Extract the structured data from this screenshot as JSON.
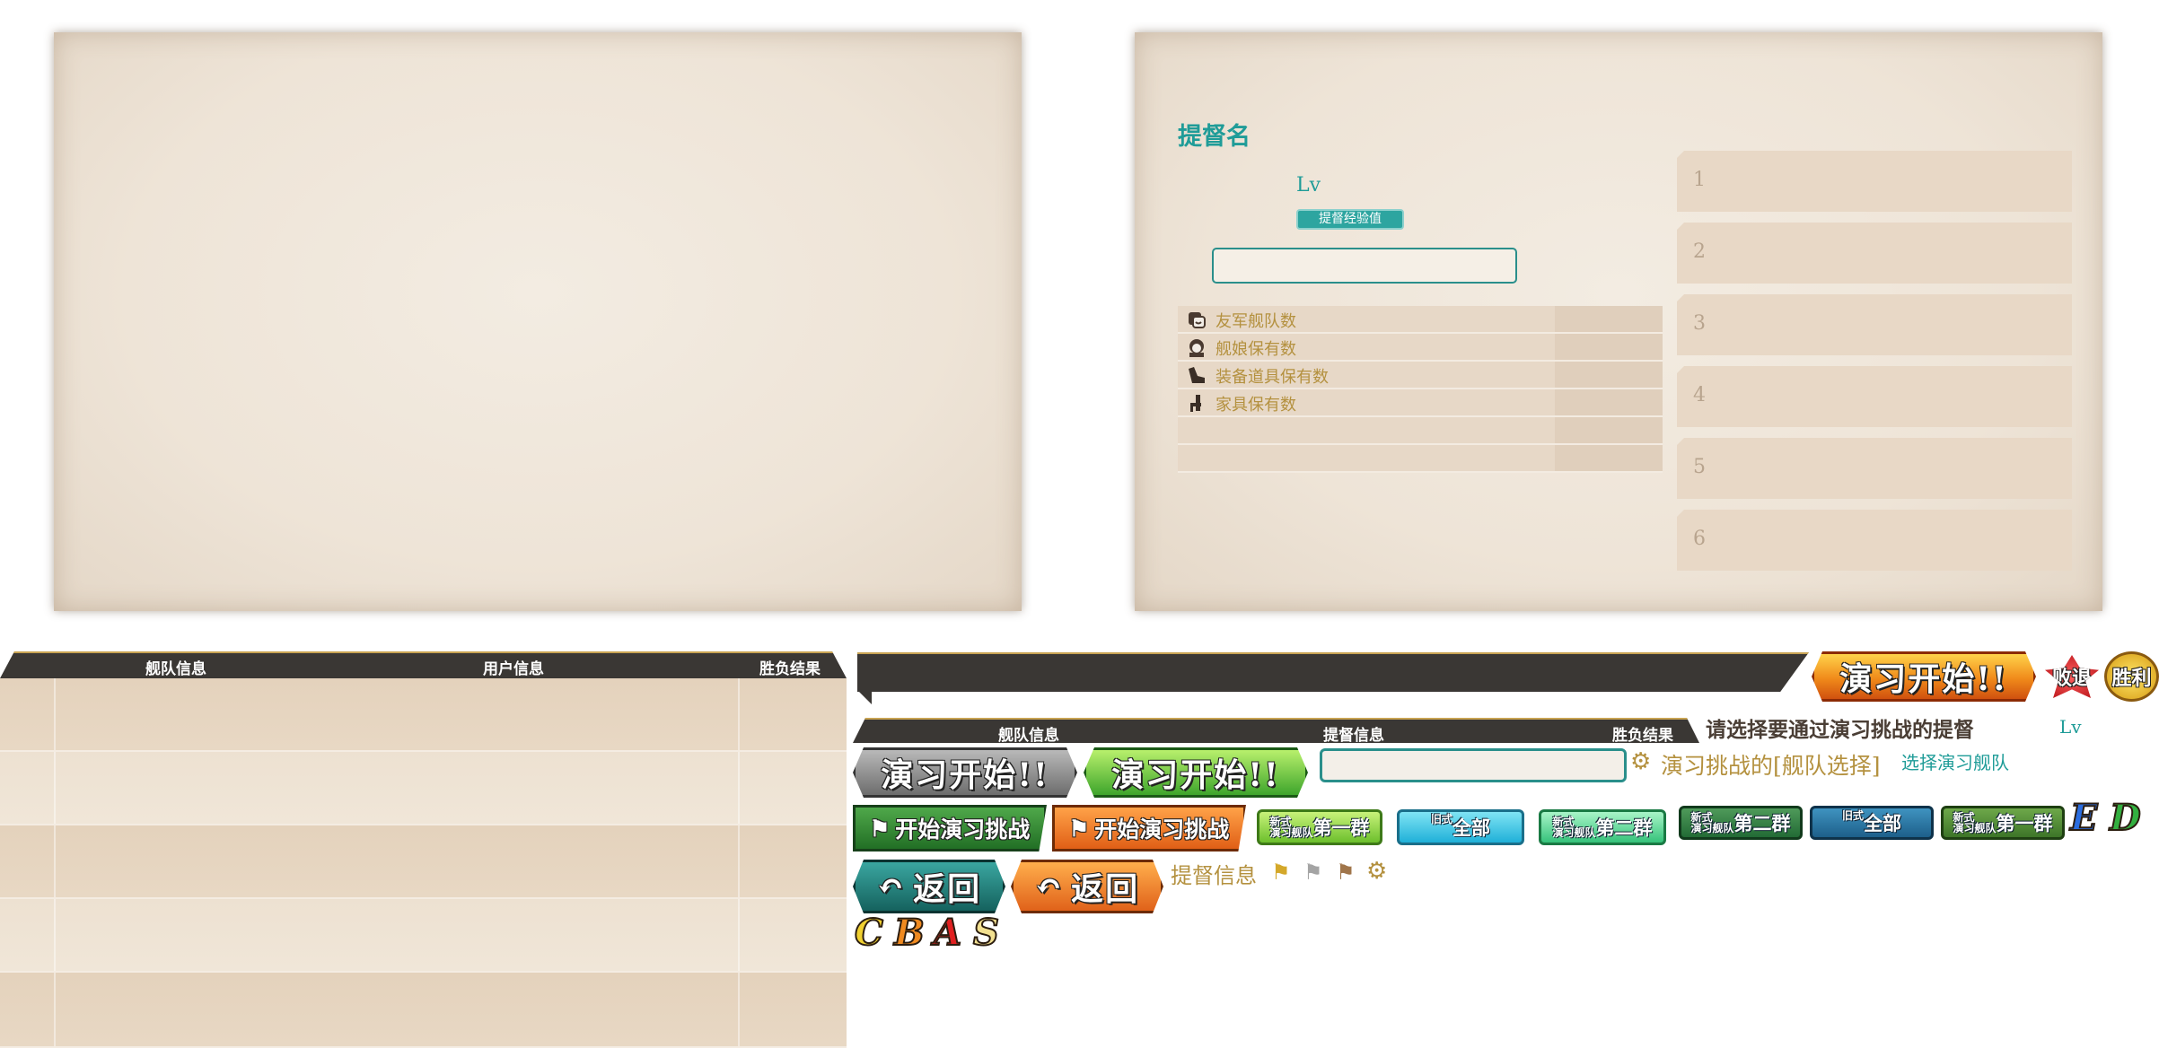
{
  "profile": {
    "admiral_name": "提督名",
    "lv_label": "Lv",
    "exp_label": "提督经验值",
    "stats": [
      {
        "icon": "friend-fleet-icon",
        "label": "友军舰队数"
      },
      {
        "icon": "shipgirl-icon",
        "label": "舰娘保有数"
      },
      {
        "icon": "equipment-icon",
        "label": "装备道具保有数"
      },
      {
        "icon": "furniture-icon",
        "label": "家具保有数"
      },
      {
        "icon": "",
        "label": ""
      },
      {
        "icon": "",
        "label": ""
      }
    ],
    "slots": [
      "1",
      "2",
      "3",
      "4",
      "5",
      "6"
    ]
  },
  "list_header": {
    "fleet": "舰队信息",
    "user": "用户信息",
    "result": "胜负结果"
  },
  "list_header_small": {
    "fleet": "舰队信息",
    "admiral": "提督信息",
    "result": "胜负结果"
  },
  "buttons": {
    "start_exercise": "演习开始!!",
    "defeat": "败退",
    "victory": "胜利",
    "start_challenge": "开始演习挑战",
    "back": "返回",
    "fleet_new_first_small": "新式",
    "fleet_new_first_sub": "演习舰队",
    "fleet_first": "第一群",
    "fleet_second": "第二群",
    "fleet_old_small": "旧式",
    "fleet_all": "全部"
  },
  "texts": {
    "select_prompt": "请选择要通过演习挑战的提督",
    "lv": "Lv",
    "fleet_select": "演习挑战的[舰队选择]",
    "select_fleet_link": "选择演习舰队",
    "admiral_info": "提督信息"
  },
  "ranks": [
    "C",
    "B",
    "A",
    "S"
  ],
  "stages": [
    "E",
    "D"
  ],
  "colors": {
    "teal": "#1f9c98",
    "gold": "#b4913f",
    "header": "#3a3734",
    "paper": "#efe6da"
  }
}
